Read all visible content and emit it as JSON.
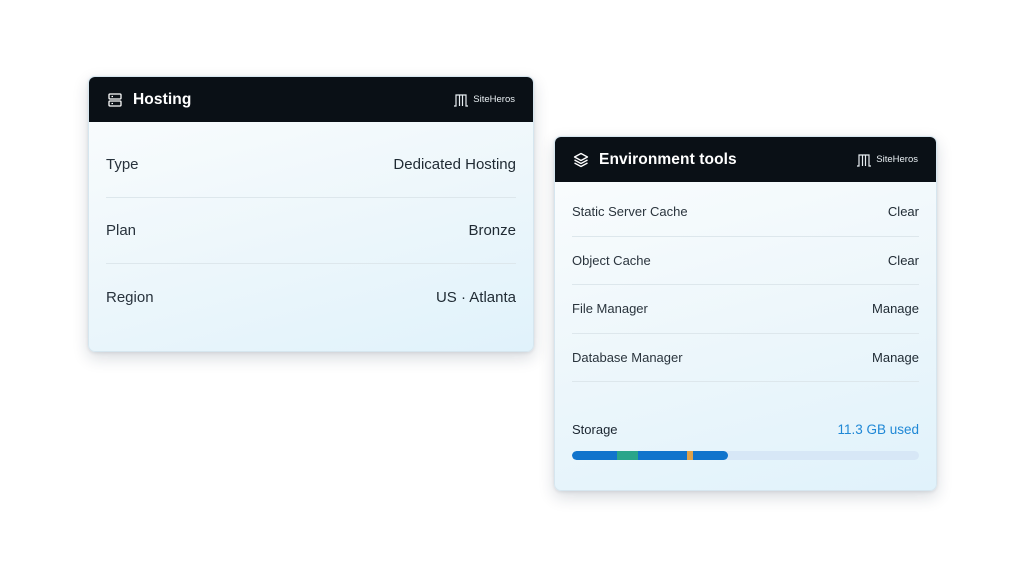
{
  "hosting_card": {
    "title": "Hosting",
    "brand": "SiteHeros",
    "icon": "server-icon",
    "rows": [
      {
        "label": "Type",
        "value": "Dedicated Hosting"
      },
      {
        "label": "Plan",
        "value": "Bronze"
      },
      {
        "label": "Region",
        "value": "US · Atlanta"
      }
    ]
  },
  "env_card": {
    "title": "Environment tools",
    "brand": "SiteHeros",
    "icon": "layers-icon",
    "tools": [
      {
        "label": "Static Server Cache",
        "action": "Clear"
      },
      {
        "label": "Object Cache",
        "action": "Clear"
      },
      {
        "label": "File Manager",
        "action": "Manage"
      },
      {
        "label": "Database Manager",
        "action": "Manage"
      }
    ],
    "storage": {
      "label": "Storage",
      "used": "11.3 GB used",
      "used_fraction": 0.45,
      "segments": [
        {
          "fraction": 0.13,
          "color": "#1174cc"
        },
        {
          "fraction": 0.06,
          "color": "#2aa58a"
        },
        {
          "fraction": 0.14,
          "color": "#1174cc"
        },
        {
          "fraction": 0.02,
          "color": "#e0a24a"
        },
        {
          "fraction": 0.1,
          "color": "#1174cc"
        }
      ],
      "track_color": "#d7e7f6"
    }
  },
  "colors": {
    "header_bg": "#0a1016",
    "accent": "#1f88d6"
  }
}
